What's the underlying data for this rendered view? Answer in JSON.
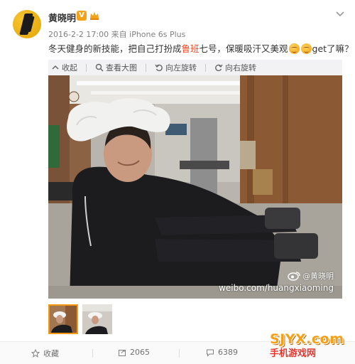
{
  "post": {
    "username": "黄晓明",
    "verified_badge": "V",
    "timestamp": "2016-2-2 17:00",
    "source": "来自 iPhone 6s Plus",
    "text_before": "冬天健身的新技能，把自己打扮成",
    "text_highlight": "鲁班",
    "text_after": "七号，保暖吸汗又美观",
    "text_end": "get了嘛？"
  },
  "media_toolbar": {
    "collapse": "收起",
    "view_large": "查看大图",
    "rotate_left": "向左旋转",
    "rotate_right": "向右旋转"
  },
  "watermark": {
    "handle": "@黄晓明",
    "url": "weibo.com/huangxiaoming"
  },
  "actions": {
    "favorite": "收藏",
    "repost_count": "2065",
    "comment_count": "6389"
  },
  "site_logo": {
    "top": "SJYX.com",
    "bottom": "手机游戏网"
  },
  "colors": {
    "highlight": "#eb4b2a",
    "meta": "#808080",
    "toolbar_bg": "#f2f2f5"
  }
}
